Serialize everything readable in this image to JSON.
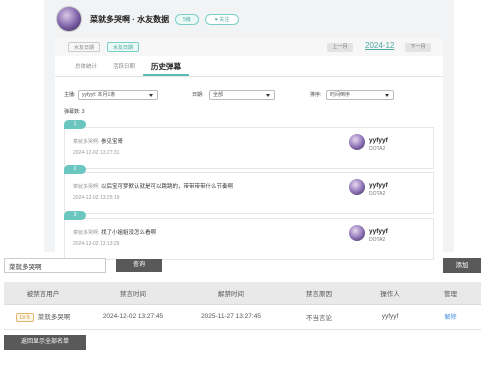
{
  "profile": {
    "username": "菜就多哭啊 · 水友数据",
    "badge": "5级",
    "follow_label": "♥ 关注"
  },
  "card_head": {
    "tag_left": "水友日期",
    "tag_active": "水友日期",
    "prev_label": "上一月",
    "month": "2024-12",
    "next_label": "下一月"
  },
  "tabs": [
    {
      "label": "总体统计"
    },
    {
      "label": "活跃日期"
    },
    {
      "label": "历史弹幕"
    }
  ],
  "filters": {
    "streamer_label": "主播:",
    "streamer_value": "yyfyyf: 本月1条",
    "date_label": "日期:",
    "date_value": "全部",
    "sort_label": "排序:",
    "sort_value": "时间倒序"
  },
  "count_text": "弹幕数: 3",
  "entries": [
    {
      "num": "1",
      "prefix": "菜就多哭啊:",
      "text": "参见宝哥",
      "time": "2024-12-02 13:27:31",
      "user": "yyfyyf",
      "game": "DOTA2"
    },
    {
      "num": "2",
      "prefix": "菜就多哭啊:",
      "text": "以后宝可梦默认就是可以跳跳的，带带带带什么节奏啊",
      "time": "2024-12-02 13:25:19",
      "user": "yyfyyf",
      "game": "DOTA2"
    },
    {
      "num": "3",
      "prefix": "菜就多哭啊:",
      "text": "找了小姐姐没怎么看啊",
      "time": "2024-12-02 13:13:29",
      "user": "yyfyyf",
      "game": "DOTA2"
    }
  ],
  "search": {
    "value": "菜就多哭啊",
    "placeholder": ""
  },
  "query_label": "查询",
  "add_label": "添加",
  "ban_table": {
    "headers": [
      "被禁言用户",
      "禁言时间",
      "解禁时间",
      "禁言原因",
      "操作人",
      "管理"
    ],
    "rows": [
      {
        "level": "LV 5",
        "user": "菜就多哭啊",
        "ban_time": "2024-12-02 13:27:45",
        "unban_time": "2025-11-27 13:27:45",
        "reason": "不当言论",
        "operator": "yyfyyf",
        "action": "解除"
      }
    ]
  },
  "show_all_label": "返回显示全部名单",
  "colors": {
    "accent": "#5bbdb5",
    "dark_button": "#595959",
    "link": "#4a90e2"
  }
}
